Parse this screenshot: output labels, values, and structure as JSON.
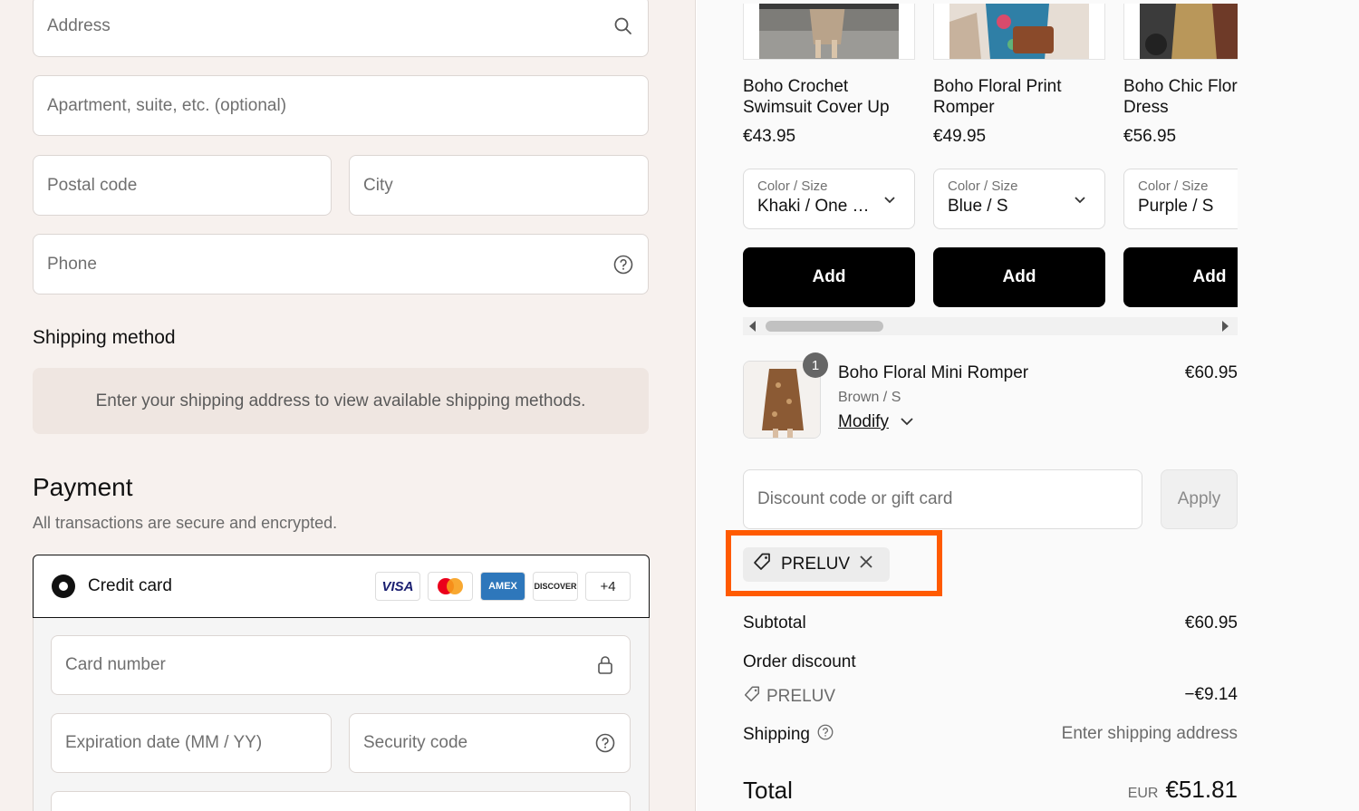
{
  "address": {
    "address_placeholder": "Address",
    "apartment_placeholder": "Apartment, suite, etc. (optional)",
    "postal_placeholder": "Postal code",
    "city_placeholder": "City",
    "phone_placeholder": "Phone"
  },
  "shipping": {
    "title": "Shipping method",
    "message": "Enter your shipping address to view available shipping methods."
  },
  "payment": {
    "title": "Payment",
    "subtitle": "All transactions are secure and encrypted.",
    "method_label": "Credit card",
    "cards": [
      "VISA",
      "",
      "AMEX",
      "DISCOVER",
      "+4"
    ],
    "card_number_placeholder": "Card number",
    "expiry_placeholder": "Expiration date (MM / YY)",
    "security_placeholder": "Security code"
  },
  "upsell": [
    {
      "name": "Boho Crochet Swimsuit Cover Up",
      "price": "€43.95",
      "select_label": "Color / Size",
      "select_value": "Khaki / One …",
      "add_label": "Add"
    },
    {
      "name": "Boho Floral Print Romper",
      "price": "€49.95",
      "select_label": "Color / Size",
      "select_value": "Blue / S",
      "add_label": "Add"
    },
    {
      "name": "Boho Chic Floral Mini Dress",
      "price": "€56.95",
      "select_label": "Color / Size",
      "select_value": "Purple / S",
      "add_label": "Add"
    }
  ],
  "cart_item": {
    "quantity": "1",
    "name": "Boho Floral Mini Romper",
    "variant": "Brown / S",
    "modify_label": "Modify",
    "price": "€60.95"
  },
  "discount": {
    "placeholder": "Discount code or gift card",
    "apply_label": "Apply",
    "applied_code": "PRELUV"
  },
  "summary": {
    "subtotal_label": "Subtotal",
    "subtotal_value": "€60.95",
    "order_discount_label": "Order discount",
    "discount_code": "PRELUV",
    "discount_value": "−€9.14",
    "shipping_label": "Shipping",
    "shipping_value": "Enter shipping address",
    "total_label": "Total",
    "currency": "EUR",
    "total_value": "€51.81"
  },
  "colors": {
    "highlight": "#ff5a00",
    "left_bg": "#f7f1ee",
    "button": "#000000"
  }
}
